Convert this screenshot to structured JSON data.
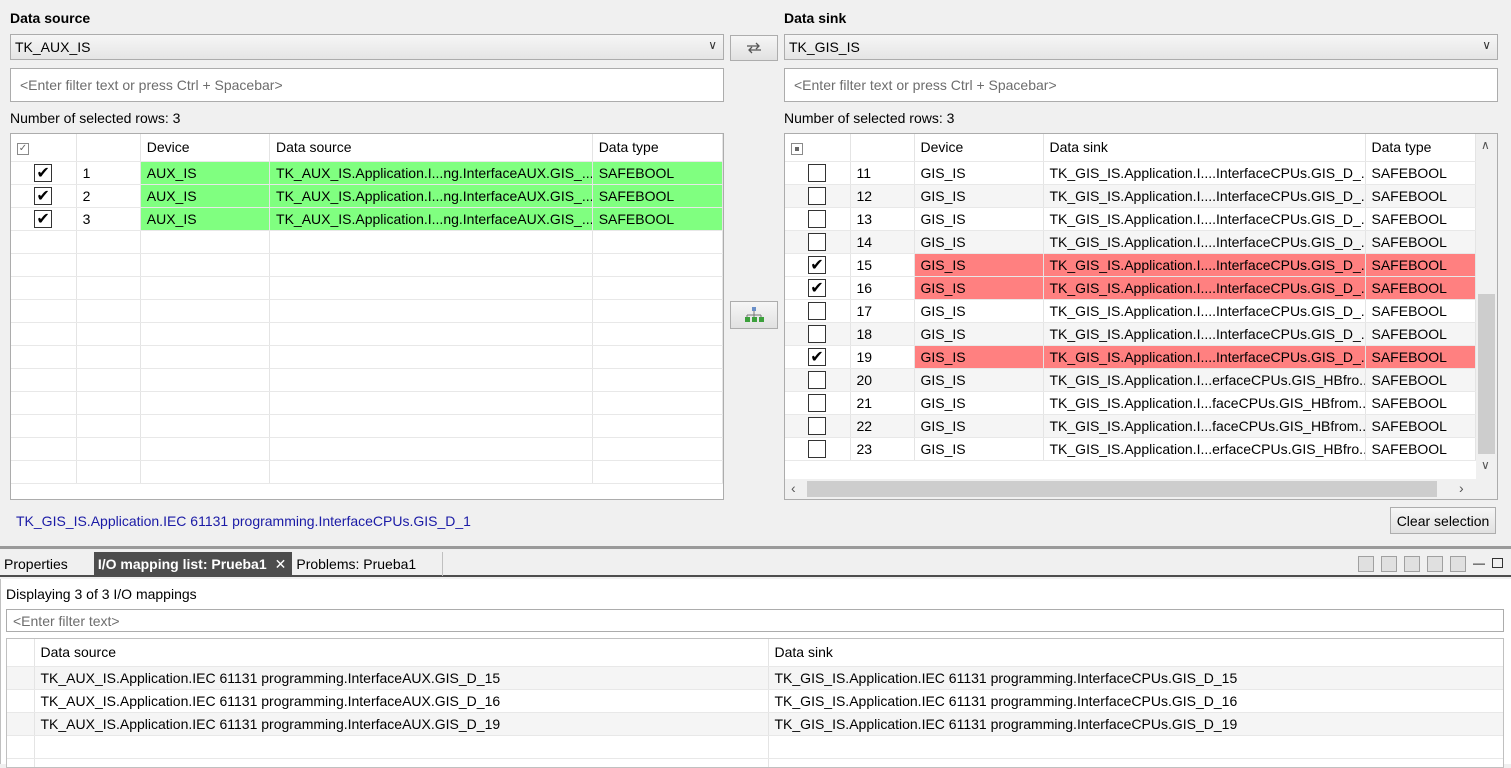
{
  "source": {
    "title": "Data source",
    "selected": "TK_AUX_IS",
    "filter_placeholder": "<Enter filter text or press Ctrl + Spacebar>",
    "selected_rows": "Number of selected rows: 3",
    "columns": [
      "Device",
      "Data source",
      "Data type"
    ],
    "rows": [
      {
        "num": "1",
        "device": "AUX_IS",
        "path": "TK_AUX_IS.Application.I...ng.InterfaceAUX.GIS_...",
        "type": "SAFEBOOL",
        "checked": true
      },
      {
        "num": "2",
        "device": "AUX_IS",
        "path": "TK_AUX_IS.Application.I...ng.InterfaceAUX.GIS_...",
        "type": "SAFEBOOL",
        "checked": true
      },
      {
        "num": "3",
        "device": "AUX_IS",
        "path": "TK_AUX_IS.Application.I...ng.InterfaceAUX.GIS_...",
        "type": "SAFEBOOL",
        "checked": true
      }
    ],
    "hover_path": "TK_GIS_IS.Application.IEC 61131 programming.InterfaceCPUs.GIS_D_1"
  },
  "sink": {
    "title": "Data sink",
    "selected": "TK_GIS_IS",
    "filter_placeholder": "<Enter filter text or press Ctrl + Spacebar>",
    "selected_rows": "Number of selected rows: 3",
    "columns": [
      "Device",
      "Data sink",
      "Data type"
    ],
    "rows": [
      {
        "num": "11",
        "device": "GIS_IS",
        "path": "TK_GIS_IS.Application.I....InterfaceCPUs.GIS_D_...",
        "type": "SAFEBOOL",
        "checked": false
      },
      {
        "num": "12",
        "device": "GIS_IS",
        "path": "TK_GIS_IS.Application.I....InterfaceCPUs.GIS_D_...",
        "type": "SAFEBOOL",
        "checked": false
      },
      {
        "num": "13",
        "device": "GIS_IS",
        "path": "TK_GIS_IS.Application.I....InterfaceCPUs.GIS_D_...",
        "type": "SAFEBOOL",
        "checked": false
      },
      {
        "num": "14",
        "device": "GIS_IS",
        "path": "TK_GIS_IS.Application.I....InterfaceCPUs.GIS_D_...",
        "type": "SAFEBOOL",
        "checked": false
      },
      {
        "num": "15",
        "device": "GIS_IS",
        "path": "TK_GIS_IS.Application.I....InterfaceCPUs.GIS_D_...",
        "type": "SAFEBOOL",
        "checked": true
      },
      {
        "num": "16",
        "device": "GIS_IS",
        "path": "TK_GIS_IS.Application.I....InterfaceCPUs.GIS_D_...",
        "type": "SAFEBOOL",
        "checked": true
      },
      {
        "num": "17",
        "device": "GIS_IS",
        "path": "TK_GIS_IS.Application.I....InterfaceCPUs.GIS_D_...",
        "type": "SAFEBOOL",
        "checked": false
      },
      {
        "num": "18",
        "device": "GIS_IS",
        "path": "TK_GIS_IS.Application.I....InterfaceCPUs.GIS_D_...",
        "type": "SAFEBOOL",
        "checked": false
      },
      {
        "num": "19",
        "device": "GIS_IS",
        "path": "TK_GIS_IS.Application.I....InterfaceCPUs.GIS_D_...",
        "type": "SAFEBOOL",
        "checked": true
      },
      {
        "num": "20",
        "device": "GIS_IS",
        "path": "TK_GIS_IS.Application.I...erfaceCPUs.GIS_HBfro...",
        "type": "SAFEBOOL",
        "checked": false
      },
      {
        "num": "21",
        "device": "GIS_IS",
        "path": "TK_GIS_IS.Application.I...faceCPUs.GIS_HBfrom...",
        "type": "SAFEBOOL",
        "checked": false
      },
      {
        "num": "22",
        "device": "GIS_IS",
        "path": "TK_GIS_IS.Application.I...faceCPUs.GIS_HBfrom...",
        "type": "SAFEBOOL",
        "checked": false
      },
      {
        "num": "23",
        "device": "GIS_IS",
        "path": "TK_GIS_IS.Application.I...erfaceCPUs.GIS_HBfro...",
        "type": "SAFEBOOL",
        "checked": false
      }
    ],
    "clear_label": "Clear selection"
  },
  "tabs": [
    {
      "label": "Properties",
      "active": false
    },
    {
      "label": "I/O mapping list: Prueba1",
      "active": true
    },
    {
      "label": "Problems: Prueba1",
      "active": false
    }
  ],
  "mapping": {
    "displaying": "Displaying 3 of 3 I/O mappings",
    "filter_placeholder": "<Enter filter text>",
    "col_source": "Data source",
    "col_sink": "Data sink",
    "rows": [
      {
        "source": "TK_AUX_IS.Application.IEC 61131 programming.InterfaceAUX.GIS_D_15",
        "sink": "TK_GIS_IS.Application.IEC 61131 programming.InterfaceCPUs.GIS_D_15"
      },
      {
        "source": "TK_AUX_IS.Application.IEC 61131 programming.InterfaceAUX.GIS_D_16",
        "sink": "TK_GIS_IS.Application.IEC 61131 programming.InterfaceCPUs.GIS_D_16"
      },
      {
        "source": "TK_AUX_IS.Application.IEC 61131 programming.InterfaceAUX.GIS_D_19",
        "sink": "TK_GIS_IS.Application.IEC 61131 programming.InterfaceCPUs.GIS_D_19"
      }
    ]
  },
  "colors": {
    "mapped_source": "#80ff80",
    "mapped_sink": "#ff8080",
    "link": "#1a1aa6"
  }
}
